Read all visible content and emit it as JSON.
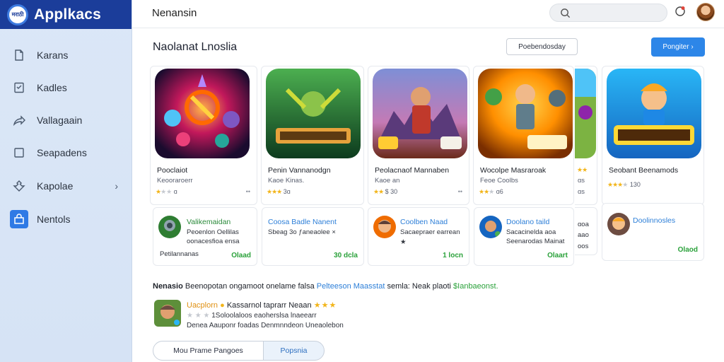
{
  "app": {
    "name": "Applkacs",
    "logo_text": "मराठी"
  },
  "sidebar": {
    "items": [
      {
        "label": "Karans",
        "icon": "document-icon"
      },
      {
        "label": "Kadles",
        "icon": "checklist-icon"
      },
      {
        "label": "Vallagaain",
        "icon": "share-arrow-icon"
      },
      {
        "label": "Seapadens",
        "icon": "square-icon"
      },
      {
        "label": "Kapolae",
        "icon": "puzzle-icon",
        "chevron": "›"
      },
      {
        "label": "Nentols",
        "icon": "store-icon",
        "active": true
      }
    ]
  },
  "header": {
    "title": "Nenansin"
  },
  "search": {
    "placeholder": ""
  },
  "section": {
    "title": "Naolanat Lnoslia",
    "sort_label": "Poebendosday",
    "primary_label": "Pongiter ›"
  },
  "featured": [
    {
      "name": "Pooclaiot",
      "sub": "Keooraroerr",
      "stars_on": "★",
      "stars_off": "★★",
      "rating": "ɑ",
      "more": "••"
    },
    {
      "name": "Penin Vannanodgn",
      "sub": "Kaoe Kinas.",
      "stars_on": "★★★",
      "stars_off": "",
      "rating": "3ɑ",
      "more": ""
    },
    {
      "name": "Peolacnaof Mannaben",
      "sub": "Kaoe an",
      "stars_on": "★★",
      "stars_off": "",
      "rating": "$ 30",
      "more": "••"
    },
    {
      "name": "Wocolpe Masraroak",
      "sub": "Feoe Coolbs",
      "stars_on": "★★",
      "stars_off": "★",
      "rating": "ɑ6",
      "more": ""
    },
    {
      "name": "",
      "sub": "",
      "stars_on": "★★",
      "stars_off": "",
      "rating": "",
      "more": ""
    },
    {
      "name": "Seobant Beenamods",
      "sub": "",
      "stars_on": "★★★",
      "stars_off": "★",
      "rating": "130",
      "more": ""
    }
  ],
  "featured_partial_lines": [
    "ɑs",
    "ɑs"
  ],
  "mini_cards": [
    {
      "title": "Valikemaidan",
      "desc1": "Peoenlon Oellilas",
      "desc2": "oonacesfioa ensa",
      "foot": "Petilannanas",
      "action": "Olaad"
    },
    {
      "title": "Coosa Badle Nanent",
      "desc1": "Sbeag 3o ƒaneaolee ×",
      "desc2": "",
      "foot": "",
      "action": "30 dcla"
    },
    {
      "title": "Coolben Naad",
      "desc1": "Sacaepraer earrean",
      "desc2": "★",
      "foot": "",
      "action": "1 locn"
    },
    {
      "title": "Doolano taild",
      "desc1": "Sacacinelda aoa",
      "desc2": "Seenarodas Mainat",
      "foot": "",
      "action": "Olaart"
    },
    {
      "title": "",
      "desc1": "ɑoa",
      "desc2": "aao",
      "desc3": "oos",
      "foot": "",
      "action": ""
    },
    {
      "title": "Doolinnosles",
      "desc1": "",
      "desc2": "",
      "foot": "",
      "action": "Olaod"
    }
  ],
  "notice": {
    "lead": "Nenasio",
    "text": "Beenopotan ongamoot onelame falsa",
    "link": "Pelteeson Maasstat",
    "mid": "semla: Neak plaoti",
    "tail": "$Ianbaeonst."
  },
  "recommendation": {
    "title_colored": "Uacplorn",
    "title_rest": "Kassarnol taprarr Neaan",
    "title_stars": "★ ★ ★",
    "line1_stars": "★ ★ ★",
    "line1": "1Soloolaloos eaoherslsa lnaeearr",
    "line2": "Denea Aauponr foadas Denmnndeon Uneaolebon"
  },
  "tabs": [
    {
      "label": "Mou Prame Pangoes"
    },
    {
      "label": "Popsnia"
    }
  ],
  "colors": {
    "brand": "#1b3d9a",
    "accent": "#2d86e8",
    "sidebar_bg": "#dbe7f7",
    "success": "#2aa13a"
  }
}
